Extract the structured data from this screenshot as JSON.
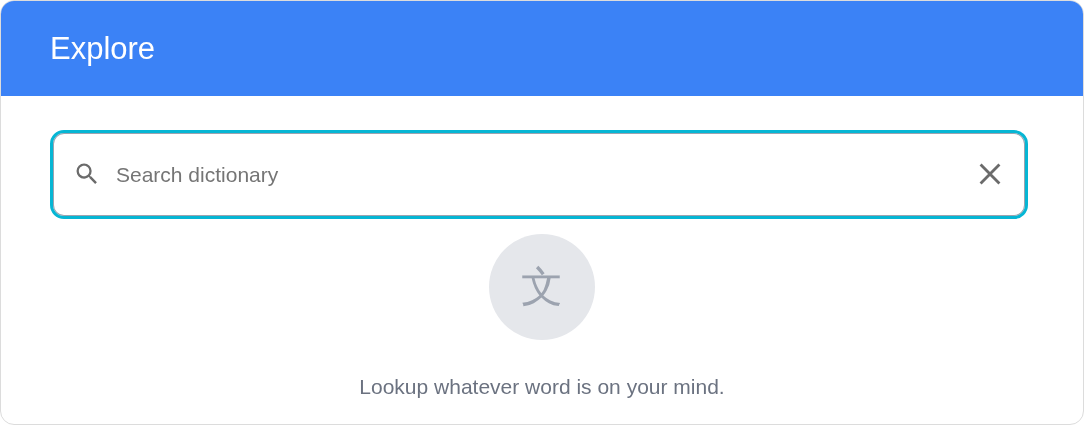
{
  "header": {
    "title": "Explore"
  },
  "search": {
    "placeholder": "Search dictionary"
  },
  "empty_state": {
    "glyph": "文",
    "message": "Lookup whatever word is on your mind."
  }
}
